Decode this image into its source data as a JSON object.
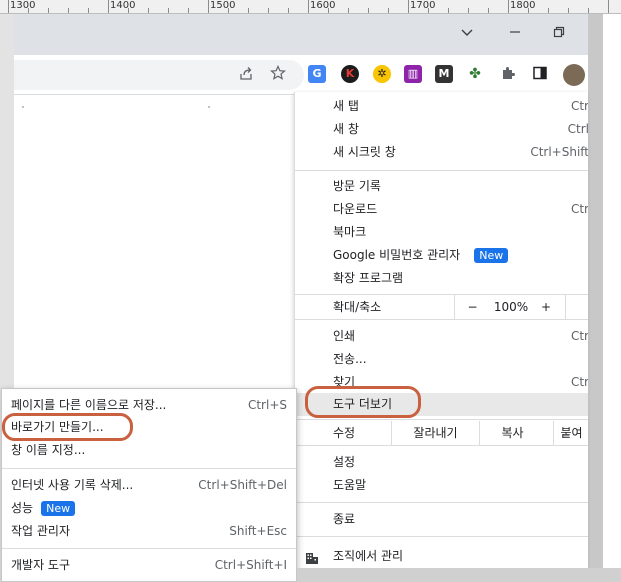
{
  "ruler": {
    "labels": [
      "1300",
      "1400",
      "1500",
      "1600",
      "1700",
      "1800"
    ]
  },
  "titlebar": {
    "icons": [
      "chevron-down-icon",
      "minimize-icon",
      "restore-icon"
    ]
  },
  "toolbar": {
    "icons": [
      "share-icon",
      "bookmark-star-icon",
      "google-translate-icon",
      "k-extension-icon",
      "extension-icon",
      "chart-extension-icon",
      "m-extension-icon",
      "plant-extension-icon",
      "puzzle-icon",
      "side-panel-icon",
      "profile-avatar"
    ]
  },
  "menu": {
    "new_tab": {
      "label": "새 탭",
      "shortcut": "Ctr"
    },
    "new_window": {
      "label": "새 창",
      "shortcut": "Ctrl"
    },
    "new_incognito": {
      "label": "새 시크릿 창",
      "shortcut": "Ctrl+Shift"
    },
    "history": {
      "label": "방문 기록"
    },
    "downloads": {
      "label": "다운로드",
      "shortcut": "Ctr"
    },
    "bookmarks": {
      "label": "북마크"
    },
    "password_manager": {
      "label": "Google 비밀번호 관리자",
      "badge": "New"
    },
    "extensions": {
      "label": "확장 프로그램"
    },
    "zoom": {
      "label": "확대/축소",
      "minus": "−",
      "value": "100%",
      "plus": "+"
    },
    "print": {
      "label": "인쇄",
      "shortcut": "Ctr"
    },
    "cast": {
      "label": "전송..."
    },
    "find": {
      "label": "찾기",
      "shortcut": "Ctr"
    },
    "more_tools": {
      "label": "도구 더보기"
    },
    "edit": {
      "label": "수정",
      "cut": "잘라내기",
      "copy": "복사",
      "paste": "붙여"
    },
    "settings": {
      "label": "설정"
    },
    "help": {
      "label": "도움말"
    },
    "exit": {
      "label": "종료"
    },
    "managed": {
      "label": "조직에서 관리"
    }
  },
  "submenu": {
    "save_page": {
      "label": "페이지를 다른 이름으로 저장...",
      "shortcut": "Ctrl+S"
    },
    "create_shortcut": {
      "label": "바로가기 만들기..."
    },
    "name_window": {
      "label": "창 이름 지정..."
    },
    "clear_data": {
      "label": "인터넷 사용 기록 삭제...",
      "shortcut": "Ctrl+Shift+Del"
    },
    "performance": {
      "label": "성능",
      "badge": "New"
    },
    "task_manager": {
      "label": "작업 관리자",
      "shortcut": "Shift+Esc"
    },
    "dev_tools": {
      "label": "개발자 도구",
      "shortcut": "Ctrl+Shift+I"
    }
  },
  "colors": {
    "accent": "#1a73e8",
    "annotation": "#c9603f",
    "titlebar": "#dee1e6"
  }
}
